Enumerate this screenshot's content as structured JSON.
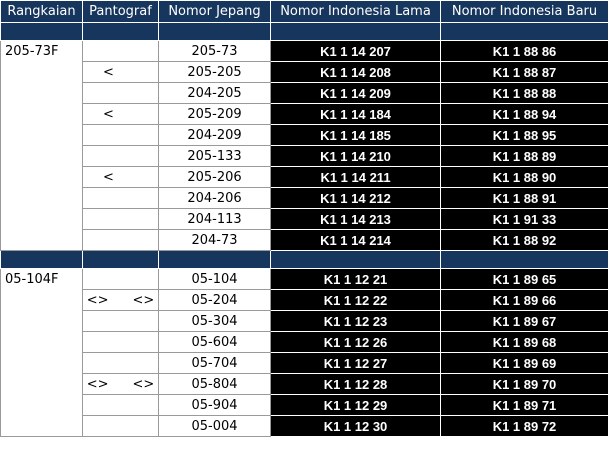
{
  "headers": [
    "Rangkaian",
    "Pantograf",
    "Nomor Jepang",
    "Nomor Indonesia Lama",
    "Nomor Indonesia Baru"
  ],
  "groups": [
    {
      "rangkaian": "205-73F",
      "rows": [
        {
          "pantograf": [
            "",
            ""
          ],
          "jepang": "205-73",
          "lama": "K1 1 14 207",
          "baru": "K1 1 88 86"
        },
        {
          "pantograf": [
            "<",
            ""
          ],
          "jepang": "205-205",
          "lama": "K1 1 14 208",
          "baru": "K1 1 88 87"
        },
        {
          "pantograf": [
            "",
            ""
          ],
          "jepang": "204-205",
          "lama": "K1 1 14 209",
          "baru": "K1 1 88 88"
        },
        {
          "pantograf": [
            "<",
            ""
          ],
          "jepang": "205-209",
          "lama": "K1 1 14 184",
          "baru": "K1 1 88 94"
        },
        {
          "pantograf": [
            "",
            ""
          ],
          "jepang": "204-209",
          "lama": "K1 1 14 185",
          "baru": "K1 1 88 95"
        },
        {
          "pantograf": [
            "",
            ""
          ],
          "jepang": "205-133",
          "lama": "K1 1 14 210",
          "baru": "K1 1 88 89"
        },
        {
          "pantograf": [
            "<",
            ""
          ],
          "jepang": "205-206",
          "lama": "K1 1 14 211",
          "baru": "K1 1 88 90"
        },
        {
          "pantograf": [
            "",
            ""
          ],
          "jepang": "204-206",
          "lama": "K1 1 14 212",
          "baru": "K1 1 88 91"
        },
        {
          "pantograf": [
            "",
            ""
          ],
          "jepang": "204-113",
          "lama": "K1 1 14 213",
          "baru": "K1 1 91 33"
        },
        {
          "pantograf": [
            "",
            ""
          ],
          "jepang": "204-73",
          "lama": "K1 1 14 214",
          "baru": "K1 1 88 92"
        }
      ]
    },
    {
      "rangkaian": "05-104F",
      "rows": [
        {
          "pantograf": [
            "",
            ""
          ],
          "jepang": "05-104",
          "lama": "K1 1 12 21",
          "baru": "K1 1 89 65"
        },
        {
          "pantograf": [
            "<>",
            "<>"
          ],
          "jepang": "05-204",
          "lama": "K1 1 12 22",
          "baru": "K1 1 89 66"
        },
        {
          "pantograf": [
            "",
            ""
          ],
          "jepang": "05-304",
          "lama": "K1 1 12 23",
          "baru": "K1 1 89 67"
        },
        {
          "pantograf": [
            "",
            ""
          ],
          "jepang": "05-604",
          "lama": "K1 1 12 26",
          "baru": "K1 1 89 68"
        },
        {
          "pantograf": [
            "",
            ""
          ],
          "jepang": "05-704",
          "lama": "K1 1 12 27",
          "baru": "K1 1 89 69"
        },
        {
          "pantograf": [
            "<>",
            "<>"
          ],
          "jepang": "05-804",
          "lama": "K1 1 12 28",
          "baru": "K1 1 89 70"
        },
        {
          "pantograf": [
            "",
            ""
          ],
          "jepang": "05-904",
          "lama": "K1 1 12 29",
          "baru": "K1 1 89 71"
        },
        {
          "pantograf": [
            "",
            ""
          ],
          "jepang": "05-004",
          "lama": "K1 1 12 30",
          "baru": "K1 1 89 72"
        }
      ]
    }
  ]
}
